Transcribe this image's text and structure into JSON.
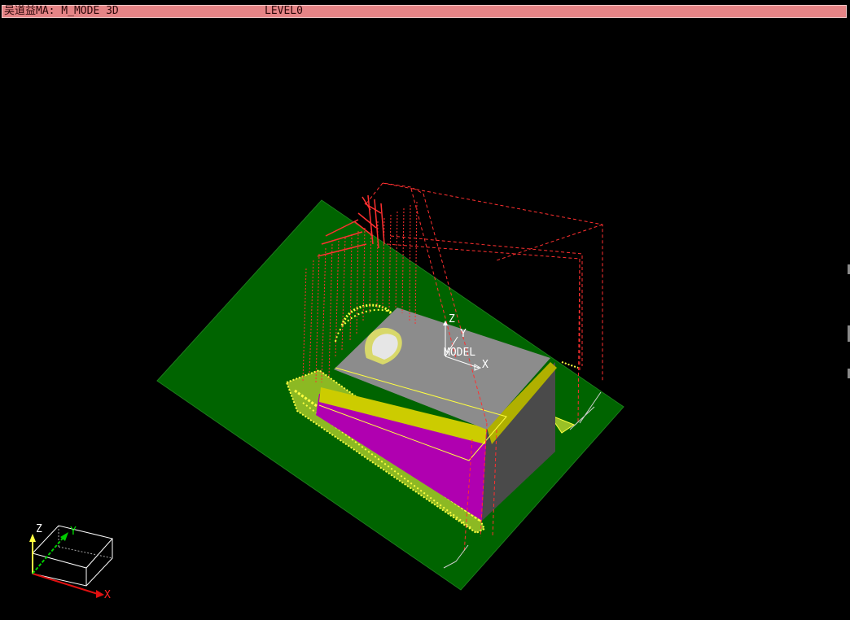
{
  "title_bar": {
    "text": "吴道益MA: M_MODE 3D",
    "level": "LEVEL0"
  },
  "model_triad": {
    "z_label": "Z",
    "y_label": "Y",
    "x_label": "X",
    "caption": "MODEL"
  },
  "view_cube": {
    "z_label": "Z",
    "y_label": "Y",
    "x_label": "X"
  },
  "colors": {
    "background": "#000000",
    "title_bar": "#e58486",
    "base_plate": "#006400",
    "part_top": "#8c8c8c",
    "part_side": "#b000b0",
    "fillet": "#d8d800",
    "toolpath": "#ff3030",
    "stock_remnant": "#ffff40"
  }
}
